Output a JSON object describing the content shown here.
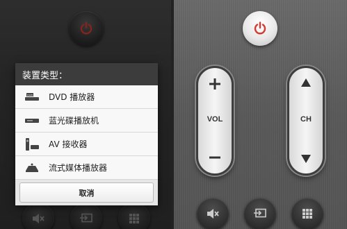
{
  "dialog": {
    "title": "装置类型：",
    "options": [
      {
        "label": "DVD 播放器",
        "icon": "dvd-player-icon"
      },
      {
        "label": "蓝光碟播放机",
        "icon": "bluray-player-icon"
      },
      {
        "label": "AV 接收器",
        "icon": "av-receiver-icon"
      },
      {
        "label": "流式媒体播放器",
        "icon": "streaming-media-player-icon"
      }
    ],
    "cancel_label": "取消"
  },
  "remote": {
    "volume_label": "VOL",
    "channel_label": "CH",
    "power_icon": "power-icon",
    "bottom_buttons": [
      "mute-icon",
      "input-source-icon",
      "grid-menu-icon"
    ]
  },
  "colors": {
    "power_red": "#d23a32",
    "dialog_header": "#3c3c3c"
  }
}
